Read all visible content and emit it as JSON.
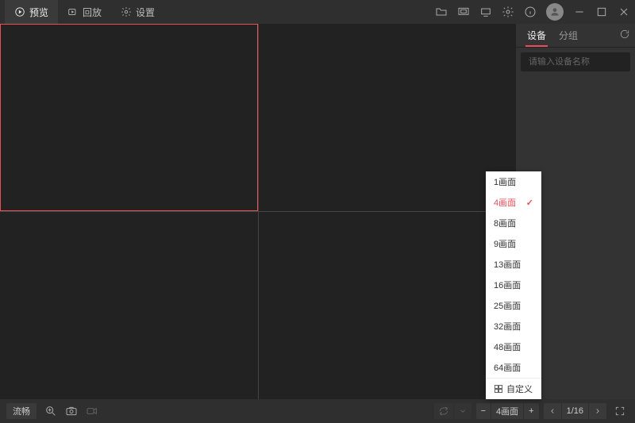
{
  "nav": {
    "preview": "预览",
    "playback": "回放",
    "settings": "设置"
  },
  "sidebar": {
    "device": "设备",
    "group": "分组",
    "search_placeholder": "请输入设备名称"
  },
  "footer": {
    "stream": "流畅",
    "layout_label": "4画面",
    "page": "1/16"
  },
  "layout_menu": {
    "items": [
      "1画面",
      "4画面",
      "8画面",
      "9画面",
      "13画面",
      "16画面",
      "25画面",
      "32画面",
      "48画面",
      "64画面"
    ],
    "selected": "4画面",
    "custom": "自定义"
  }
}
